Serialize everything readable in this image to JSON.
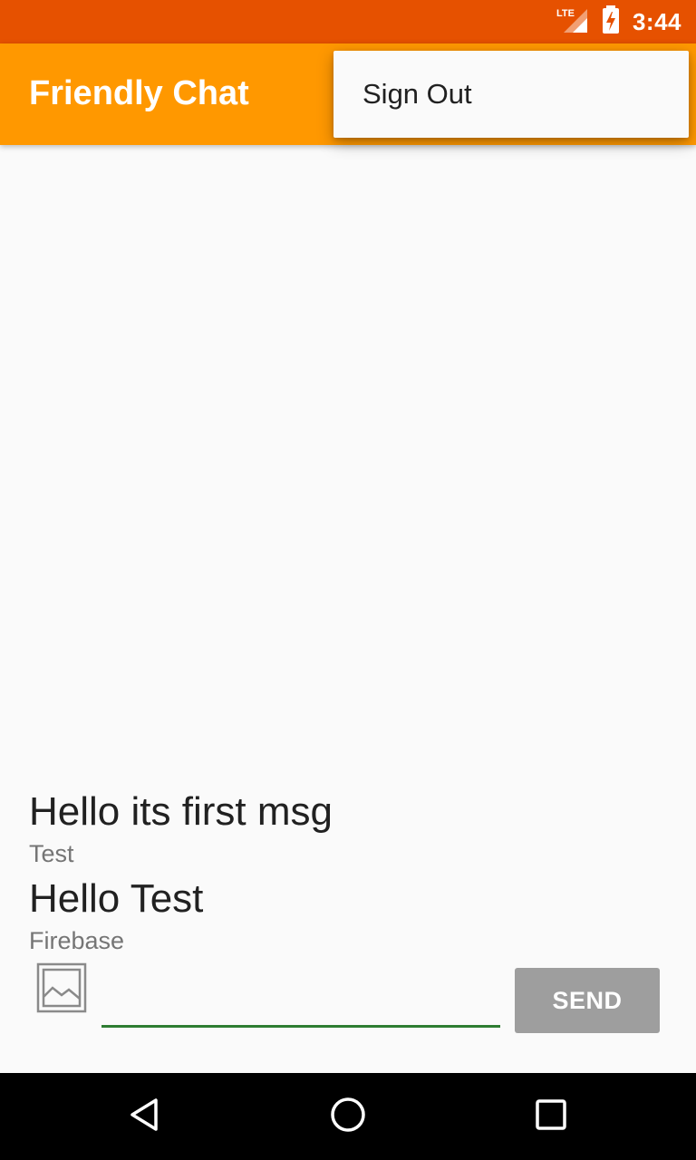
{
  "status_bar": {
    "network": "LTE",
    "time": "3:44"
  },
  "app_bar": {
    "title": "Friendly Chat"
  },
  "overflow_menu": {
    "items": [
      {
        "label": "Sign Out"
      }
    ]
  },
  "messages": [
    {
      "text": "Hello its first msg",
      "sender": "Test"
    },
    {
      "text": "Hello Test",
      "sender": "Firebase"
    }
  ],
  "composer": {
    "input_value": "",
    "send_label": "SEND",
    "image_icon": "image-icon"
  },
  "nav_bar": {
    "back_icon": "back-triangle-icon",
    "home_icon": "home-circle-icon",
    "recents_icon": "recents-square-icon"
  },
  "colors": {
    "status_bar": "#e65100",
    "app_bar": "#ff9800",
    "input_underline": "#2e7d32",
    "send_button": "#9e9e9e"
  }
}
